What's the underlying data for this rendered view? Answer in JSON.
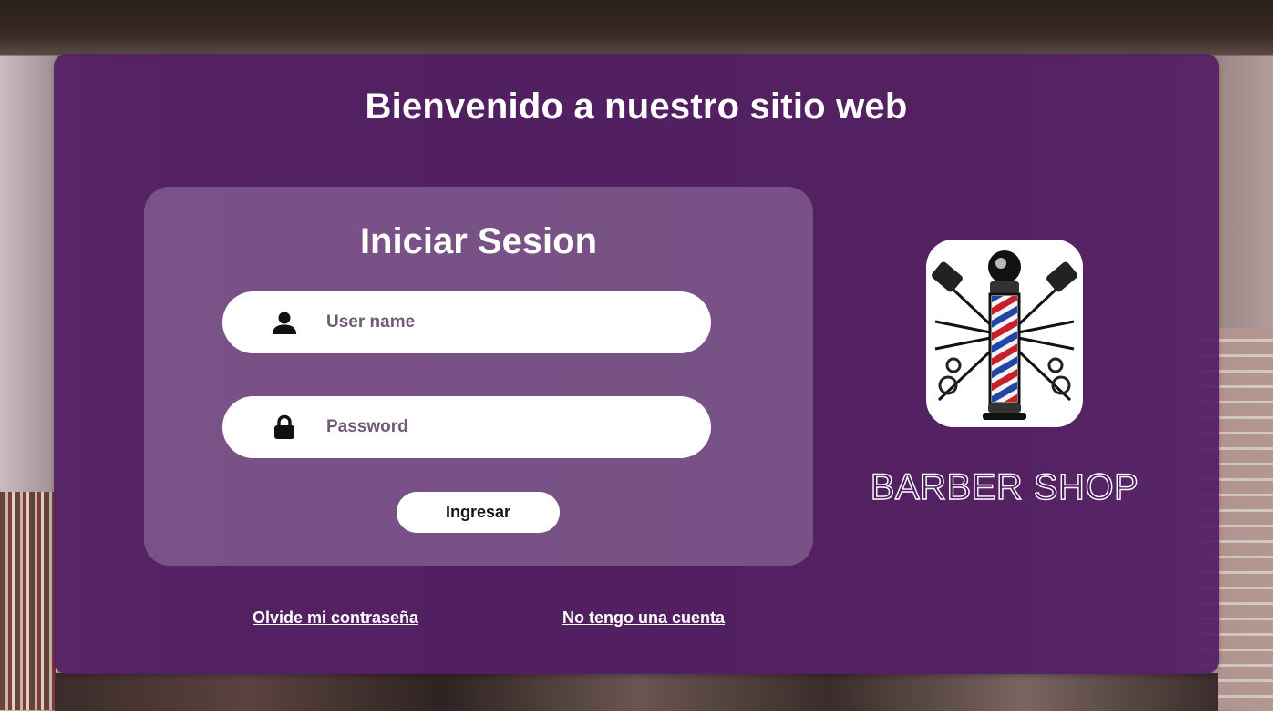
{
  "header": {
    "title": "Bienvenido a nuestro sitio web"
  },
  "login": {
    "title": "Iniciar Sesion",
    "username": {
      "placeholder": "User name",
      "value": "",
      "icon": "user-icon"
    },
    "password": {
      "placeholder": "Password",
      "value": "",
      "icon": "lock-icon"
    },
    "submit_label": "Ingresar"
  },
  "links": {
    "forgot_password": "Olvide mi contraseña",
    "no_account": "No tengo una cuenta"
  },
  "brand": {
    "name": "BARBER SHOP",
    "logo": "barber-pole-logo"
  },
  "colors": {
    "panel": "#541E64",
    "card": "#AF96B9",
    "input_bg": "#FFFFFF",
    "placeholder_text": "#6F5C74",
    "button_bg": "#FFFFFF",
    "text_light": "#FFFFFF"
  }
}
